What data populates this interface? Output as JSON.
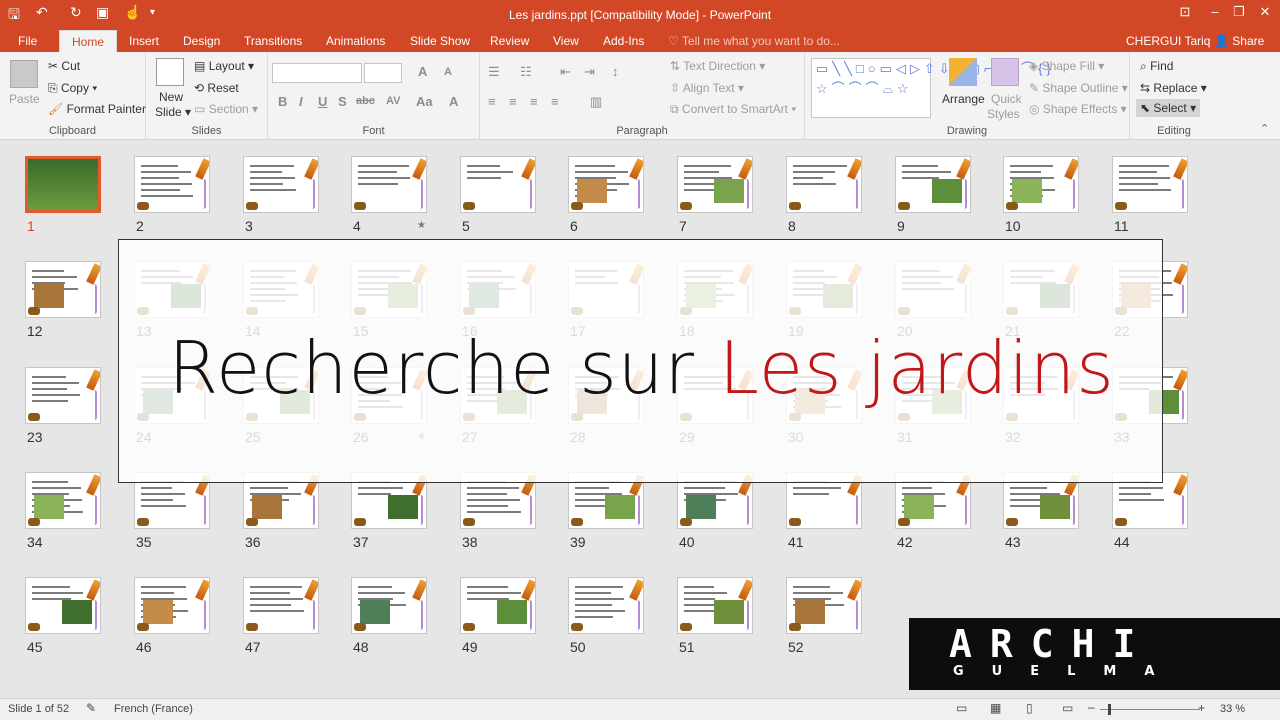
{
  "window": {
    "title": "Les jardins.ppt [Compatibility Mode] - PowerPoint",
    "buttons": {
      "help": "⊡",
      "minimize": "–",
      "restore": "❐",
      "close": "✕"
    }
  },
  "tabs": [
    "File",
    "Home",
    "Insert",
    "Design",
    "Transitions",
    "Animations",
    "Slide Show",
    "Review",
    "View",
    "Add-Ins"
  ],
  "tell_me": "Tell me what you want to do...",
  "user": "CHERGUI Tariq",
  "share": "Share",
  "ribbon": {
    "clipboard": {
      "label": "Clipboard",
      "paste": "Paste",
      "cut": "Cut",
      "copy": "Copy",
      "format_painter": "Format Painter"
    },
    "slides": {
      "label": "Slides",
      "new_slide_1": "New",
      "new_slide_2": "Slide",
      "layout": "Layout",
      "reset": "Reset",
      "section": "Section"
    },
    "font": {
      "label": "Font",
      "bold": "B",
      "italic": "I",
      "underline": "U",
      "shadow": "S",
      "strike": "abc",
      "spacing": "AV",
      "case": "Aa",
      "color": "A"
    },
    "paragraph": {
      "label": "Paragraph",
      "text_direction": "Text Direction",
      "align_text": "Align Text",
      "convert": "Convert to SmartArt"
    },
    "drawing": {
      "label": "Drawing",
      "arrange": "Arrange",
      "quick_styles_1": "Quick",
      "quick_styles_2": "Styles",
      "shape_fill": "Shape Fill",
      "shape_outline": "Shape Outline",
      "shape_effects": "Shape Effects"
    },
    "editing": {
      "label": "Editing",
      "find": "Find",
      "replace": "Replace",
      "select": "Select"
    }
  },
  "slides": {
    "numbers": [
      "1",
      "2",
      "3",
      "4",
      "5",
      "6",
      "7",
      "8",
      "9",
      "10",
      "11",
      "12",
      "13",
      "14",
      "15",
      "16",
      "17",
      "18",
      "19",
      "20",
      "21",
      "22",
      "23",
      "24",
      "25",
      "26",
      "27",
      "28",
      "29",
      "30",
      "31",
      "32",
      "33",
      "34",
      "35",
      "36",
      "37",
      "38",
      "39",
      "40",
      "41",
      "42",
      "43",
      "44",
      "45",
      "46",
      "47",
      "48",
      "49",
      "50",
      "51",
      "52"
    ],
    "selected": "1",
    "starred": [
      "4",
      "26"
    ]
  },
  "overlay": {
    "headline_black": "Recherche sur ",
    "headline_red": "Les jardins"
  },
  "logo": {
    "big": "ARCHI",
    "small": "GUELMA"
  },
  "status": {
    "slide": "Slide 1 of 52",
    "language": "French (France)",
    "zoom": "33 %"
  },
  "colors": {
    "accent": "#d24726",
    "headline_red": "#c01818"
  }
}
